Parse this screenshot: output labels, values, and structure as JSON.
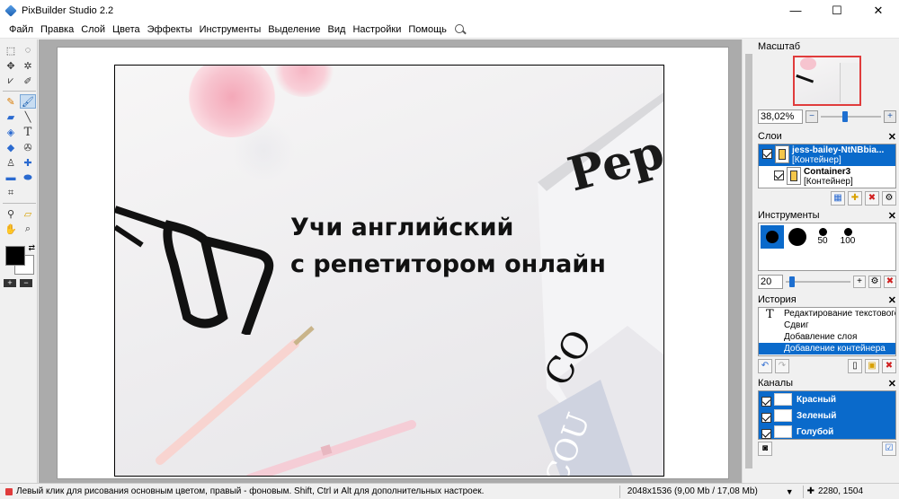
{
  "window": {
    "title": "PixBuilder Studio 2.2",
    "minimize": "—",
    "maximize": "☐",
    "close": "✕"
  },
  "menu": [
    "Файл",
    "Правка",
    "Слой",
    "Цвета",
    "Эффекты",
    "Инструменты",
    "Выделение",
    "Вид",
    "Настройки",
    "Помощь"
  ],
  "canvas": {
    "headline_line1": "Учи английский",
    "headline_line2": "с репетитором онлайн",
    "magazine_word": "Pep",
    "magazine_word2": "CO",
    "magazine_word3": "COU"
  },
  "panels": {
    "navigator": {
      "title": "Масштаб",
      "zoom": "38,02%",
      "zoom_level": 0.4
    },
    "layers": {
      "title": "Слои",
      "items": [
        {
          "name": "jess-bailey-NtNBbia...",
          "type": "[Контейнер]",
          "selected": true
        },
        {
          "name": "Container3",
          "type": "[Контейнер]",
          "selected": false
        }
      ]
    },
    "tools": {
      "title": "Инструменты",
      "brushes": [
        "",
        "",
        "50",
        "100"
      ],
      "size": "20",
      "size_level": 0.1
    },
    "history": {
      "title": "История",
      "items": [
        "Редактирование текстового",
        "Сдвиг",
        "Добавление слоя",
        "Добавление контейнера"
      ]
    },
    "channels": {
      "title": "Каналы",
      "items": [
        "Красный",
        "Зеленый",
        "Голубой"
      ]
    }
  },
  "status": {
    "hint": "Левый клик для рисования основным цветом, правый - фоновым. Shift, Ctrl и Alt для дополнительных настроек.",
    "image_info": "2048x1536  (9,00 Mb / 17,08 Mb)",
    "coords": "2280, 1504"
  },
  "colors": {
    "accent": "#0a6acb",
    "foreground": "#000000",
    "background": "#ffffff",
    "canvas_bg": "#ababab"
  }
}
